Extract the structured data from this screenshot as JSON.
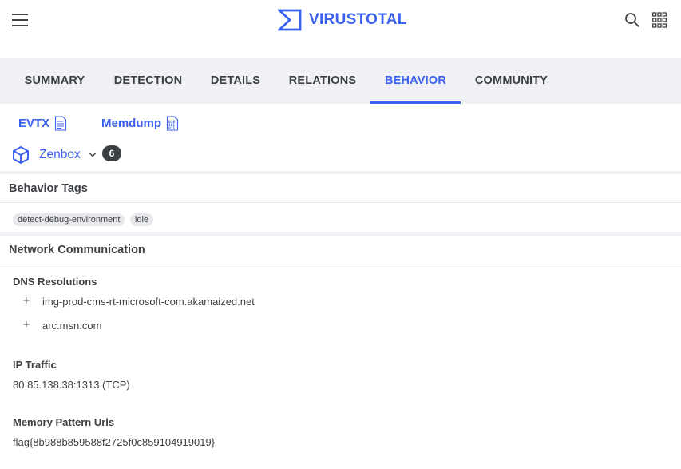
{
  "brand": {
    "name": "VIRUSTOTAL",
    "accent": "#3b61f0"
  },
  "header": {
    "menu_icon": "hamburger-menu-icon",
    "search_icon": "search-icon",
    "apps_icon": "apps-grid-icon"
  },
  "tabs": [
    {
      "label": "SUMMARY"
    },
    {
      "label": "DETECTION"
    },
    {
      "label": "DETAILS"
    },
    {
      "label": "RELATIONS"
    },
    {
      "label": "BEHAVIOR",
      "active": true
    },
    {
      "label": "COMMUNITY"
    }
  ],
  "reports": [
    {
      "label": "EVTX",
      "icon": "document-icon"
    },
    {
      "label": "Memdump",
      "icon": "binary-file-icon"
    }
  ],
  "sandbox": {
    "name": "Zenbox",
    "count": "6",
    "icon": "cube-icon"
  },
  "behavior_tags": {
    "title": "Behavior Tags",
    "tags": [
      "detect-debug-environment",
      "idle"
    ]
  },
  "network": {
    "title": "Network Communication",
    "dns": {
      "title": "DNS Resolutions",
      "items": [
        "img-prod-cms-rt-microsoft-com.akamaized.net",
        "arc.msn.com"
      ]
    },
    "ip_traffic": {
      "title": "IP Traffic",
      "items": [
        "80.85.138.38:1313 (TCP)"
      ]
    },
    "memory_urls": {
      "title": "Memory Pattern Urls",
      "items": [
        "flag{8b988b859588f2725f0c859104919019}"
      ]
    }
  }
}
